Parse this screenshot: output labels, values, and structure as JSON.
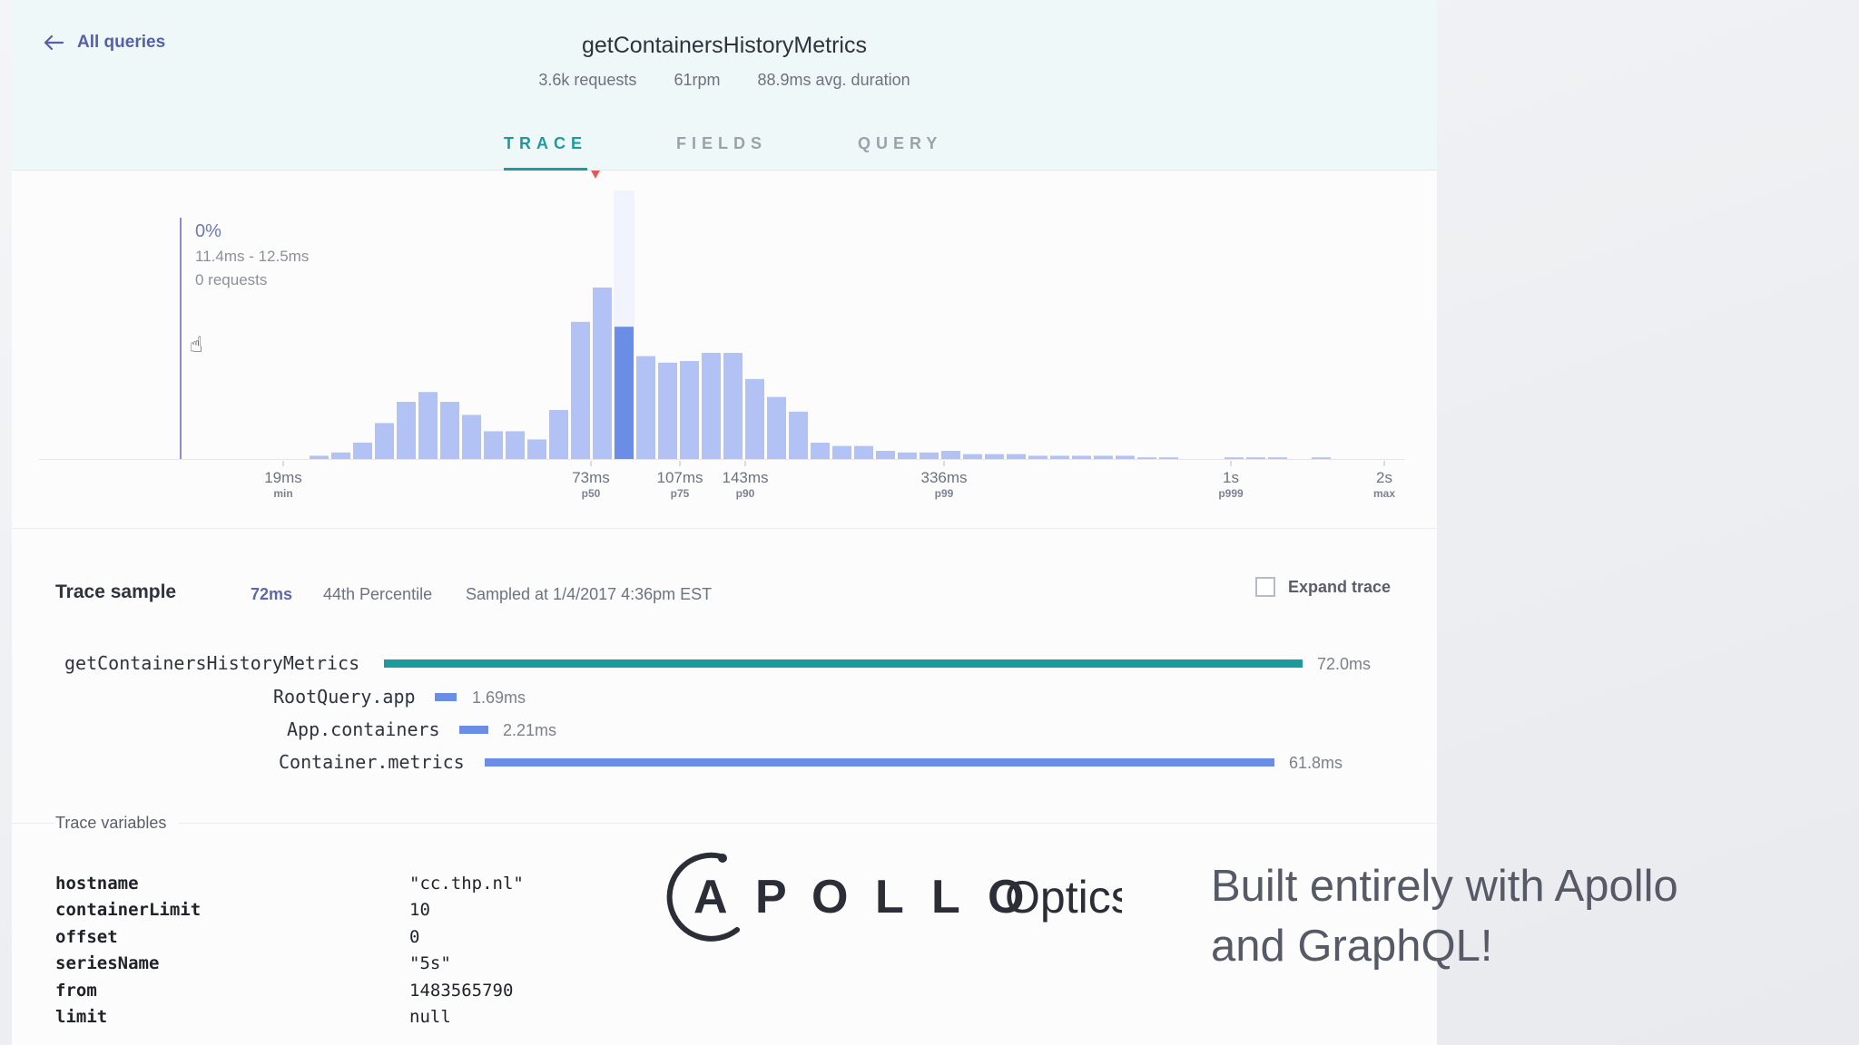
{
  "header": {
    "back_label": "All queries",
    "title": "getContainersHistoryMetrics",
    "stats": [
      "3.6k requests",
      "61rpm",
      "88.9ms avg. duration"
    ]
  },
  "tabs": [
    {
      "label": "TRACE",
      "active": true
    },
    {
      "label": "FIELDS",
      "active": false
    },
    {
      "label": "QUERY",
      "active": false
    }
  ],
  "tooltip": {
    "percent": "0%",
    "range": "11.4ms - 12.5ms",
    "requests": "0 requests"
  },
  "chart_data": {
    "type": "bar",
    "title": "",
    "xlabel": "",
    "ylabel": "",
    "x_scale": "log",
    "values": [
      0,
      0,
      0,
      0,
      0,
      0,
      0,
      0,
      0,
      0,
      0,
      0,
      2,
      4,
      10,
      22,
      35,
      41,
      35,
      27,
      17,
      17,
      12,
      30,
      84,
      105,
      81,
      63,
      59,
      60,
      65,
      65,
      49,
      38,
      29,
      10,
      8,
      8,
      5,
      4,
      4,
      5,
      3,
      3,
      3,
      2,
      2,
      2,
      2,
      2,
      1,
      1,
      0,
      0,
      1,
      1,
      1,
      0,
      1,
      0,
      0,
      0,
      0,
      0,
      0,
      1,
      0
    ],
    "highlighted_bar": 26,
    "ticks": [
      {
        "label": "19ms",
        "sub": "min"
      },
      {
        "label": "73ms",
        "sub": "p50"
      },
      {
        "label": "107ms",
        "sub": "p75"
      },
      {
        "label": "143ms",
        "sub": "p90"
      },
      {
        "label": "336ms",
        "sub": "p99"
      },
      {
        "label": "1s",
        "sub": "p999"
      },
      {
        "label": "2s",
        "sub": "max"
      }
    ],
    "colors": {
      "bar": "#b3c2f4",
      "highlight": "#6a8ee6"
    }
  },
  "trace": {
    "title": "Trace sample",
    "duration": "72ms",
    "percentile": "44th Percentile",
    "sampled": "Sampled at 1/4/2017 4:36pm EST",
    "expand_label": "Expand trace",
    "expand_checked": false,
    "spans": [
      {
        "name": "getContainersHistoryMetrics",
        "duration": "72.0ms",
        "color": "#1c9b9f"
      },
      {
        "name": "RootQuery.app",
        "duration": "1.69ms",
        "color": "#6a8ee6"
      },
      {
        "name": "App.containers",
        "duration": "2.21ms",
        "color": "#6a8ee6"
      },
      {
        "name": "Container.metrics",
        "duration": "61.8ms",
        "color": "#6a8ee6"
      }
    ]
  },
  "variables": {
    "title": "Trace variables",
    "items": [
      {
        "key": "hostname",
        "value": "\"cc.thp.nl\""
      },
      {
        "key": "containerLimit",
        "value": "10"
      },
      {
        "key": "offset",
        "value": "0"
      },
      {
        "key": "seriesName",
        "value": "\"5s\""
      },
      {
        "key": "from",
        "value": "1483565790"
      },
      {
        "key": "limit",
        "value": "null"
      }
    ]
  },
  "branding": {
    "logo_word": "APOLLO",
    "product": "Optics",
    "tagline_line1": "Built entirely with Apollo",
    "tagline_line2": "and GraphQL!"
  }
}
